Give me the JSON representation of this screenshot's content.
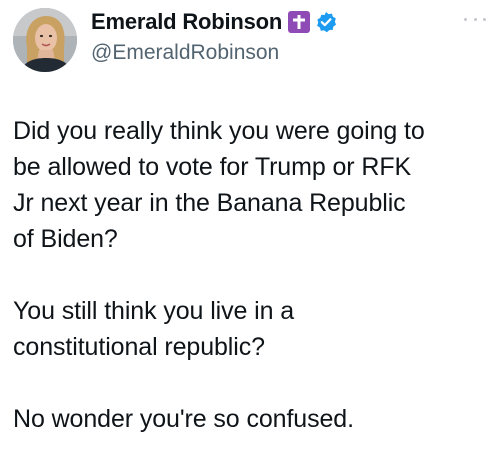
{
  "tweet": {
    "author": {
      "display_name": "Emerald Robinson",
      "handle": "@EmeraldRobinson",
      "badge_icon": "cross-badge-icon",
      "verified_icon": "verified-checkmark-icon",
      "badge_color": "#8e4bb6",
      "verified_color": "#1d9bf0"
    },
    "menu_icon": "more-options-icon",
    "paragraphs": [
      "Did you really think you were going to\nbe allowed to vote for Trump or RFK\nJr next year in the Banana Republic\nof Biden?",
      "You still think you live in a\nconstitutional republic?",
      "No wonder you're so confused."
    ]
  }
}
